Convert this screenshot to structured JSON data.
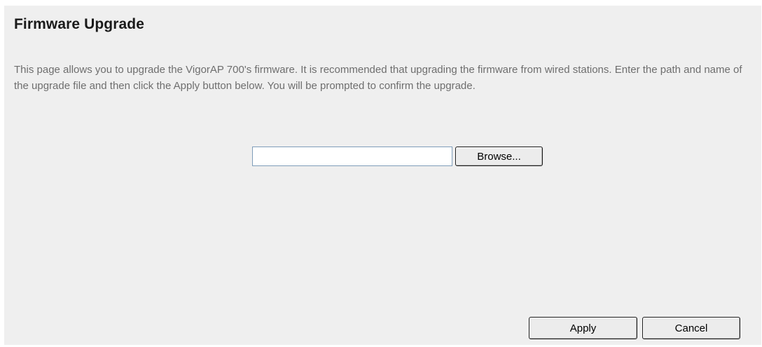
{
  "page": {
    "title": "Firmware Upgrade",
    "description": "This page allows you to upgrade the VigorAP 700's firmware. It is recommended that upgrading the firmware from wired stations. Enter the path and name of the upgrade file and then click the Apply button below. You will be prompted to confirm the upgrade."
  },
  "upload": {
    "file_path_value": "",
    "browse_label": "Browse..."
  },
  "actions": {
    "apply_label": "Apply",
    "cancel_label": "Cancel"
  },
  "colors": {
    "panel_background": "#efefef",
    "description_text": "#6e6e6e",
    "input_border": "#7f9db9"
  }
}
